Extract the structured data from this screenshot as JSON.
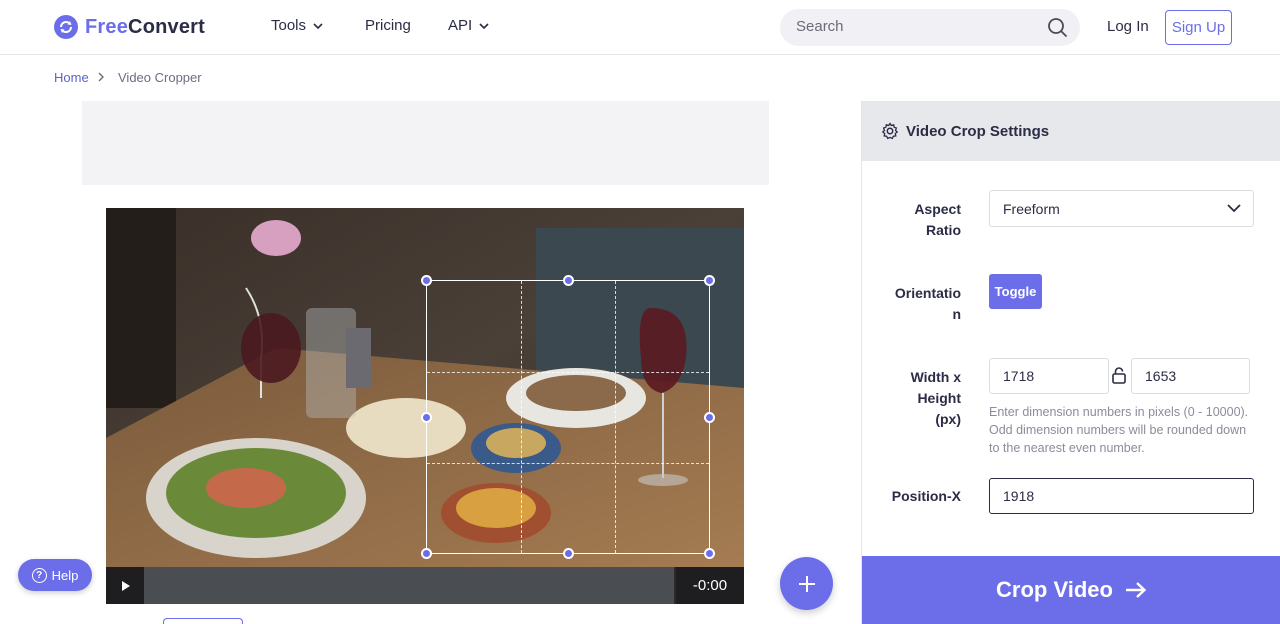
{
  "brand": {
    "free": "Free",
    "convert": "Convert"
  },
  "nav": {
    "tools": "Tools",
    "pricing": "Pricing",
    "api": "API"
  },
  "search": {
    "placeholder": "Search"
  },
  "auth": {
    "login": "Log In",
    "signup": "Sign Up"
  },
  "breadcrumb": {
    "home": "Home",
    "current": "Video Cropper"
  },
  "player": {
    "time": "-0:00"
  },
  "help": {
    "label": "Help"
  },
  "settings": {
    "title": "Video Crop Settings",
    "aspect_label_1": "Aspect",
    "aspect_label_2": "Ratio",
    "aspect_value": "Freeform",
    "orientation_label_1": "Orientatio",
    "orientation_label_2": "n",
    "toggle_label": "Toggle",
    "wh_label_1": "Width x",
    "wh_label_2": "Height",
    "wh_label_3": "(px)",
    "width_value": "1718",
    "height_value": "1653",
    "hint": "Enter dimension numbers in pixels (0 - 10000). Odd dimension numbers will be rounded down to the nearest even number.",
    "posx_label": "Position-X",
    "posx_value": "1918"
  },
  "action": {
    "crop": "Crop Video"
  },
  "colors": {
    "accent": "#6b6ee8",
    "dark_text": "#2b2c45"
  }
}
